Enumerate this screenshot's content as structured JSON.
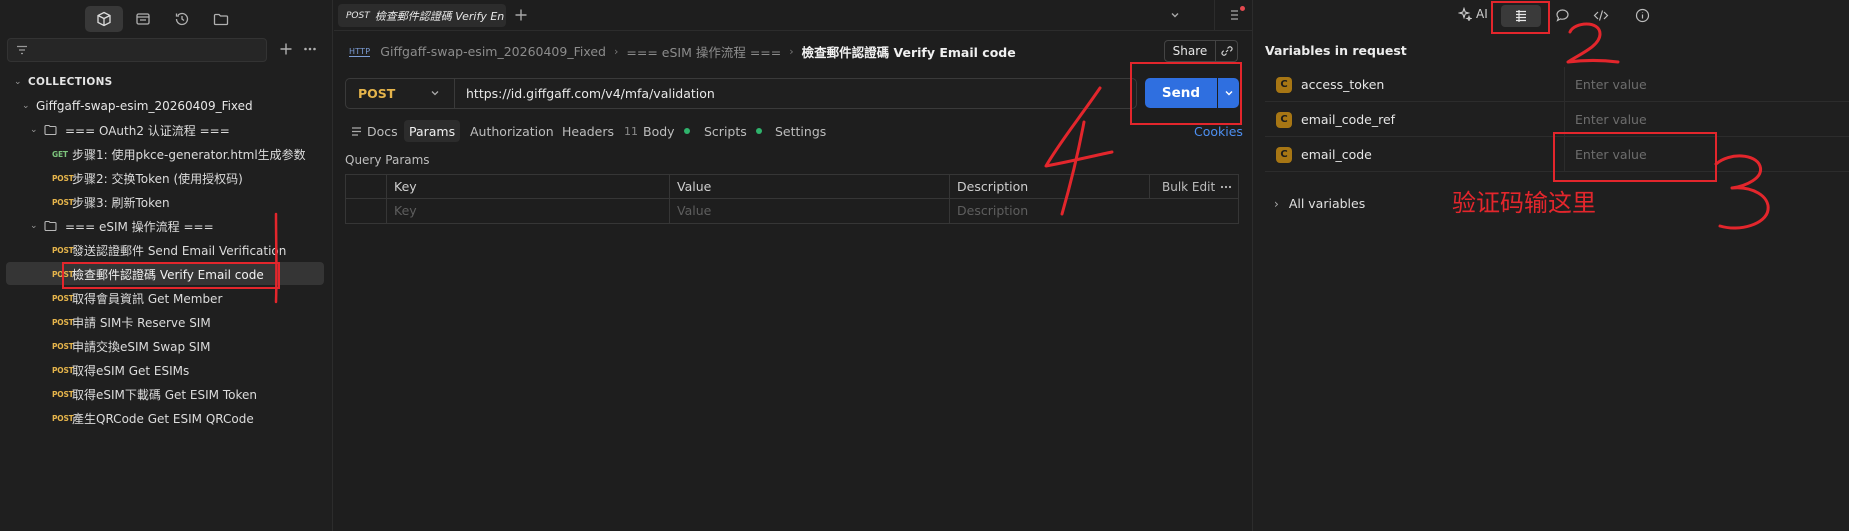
{
  "sidebar": {
    "section_title": "COLLECTIONS",
    "collection_name": "Giffgaff-swap-esim_20260409_Fixed",
    "folders": [
      {
        "name": "=== OAuth2 认证流程 ===",
        "requests": [
          {
            "method": "GET",
            "name": "步骤1: 使用pkce-generator.html生成参数"
          },
          {
            "method": "POST",
            "name": "步骤2: 交换Token (使用授权码)"
          },
          {
            "method": "POST",
            "name": "步骤3: 刷新Token"
          }
        ]
      },
      {
        "name": "=== eSIM 操作流程 ===",
        "requests": [
          {
            "method": "POST",
            "name": "發送認證郵件 Send Email Verification"
          },
          {
            "method": "POST",
            "name": "檢查郵件認證碼 Verify Email code"
          },
          {
            "method": "POST",
            "name": "取得會員資訊 Get Member"
          },
          {
            "method": "POST",
            "name": "申請 SIM卡 Reserve SIM"
          },
          {
            "method": "POST",
            "name": "申請交換eSIM Swap SIM"
          },
          {
            "method": "POST",
            "name": "取得eSIM Get ESIMs"
          },
          {
            "method": "POST",
            "name": "取得eSIM下載碼 Get ESIM Token"
          },
          {
            "method": "POST",
            "name": "產生QRCode Get ESIM QRCode"
          }
        ]
      }
    ]
  },
  "tab": {
    "method": "POST",
    "title": "檢查郵件認證碼 Verify En"
  },
  "breadcrumb": {
    "collection": "Giffgaff-swap-esim_20260409_Fixed",
    "folder": "=== eSIM 操作流程 ===",
    "request": "檢查郵件認證碼 Verify Email code",
    "share_label": "Share",
    "http_badge": "HTTP"
  },
  "request": {
    "method": "POST",
    "url": "https://id.giffgaff.com/v4/mfa/validation",
    "send_label": "Send",
    "tabs": [
      {
        "label": "Docs"
      },
      {
        "label": "Params"
      },
      {
        "label": "Authorization"
      },
      {
        "label": "Headers",
        "count": "11"
      },
      {
        "label": "Body"
      },
      {
        "label": "Scripts"
      },
      {
        "label": "Settings"
      }
    ],
    "cookies_label": "Cookies",
    "query_params_title": "Query Params",
    "columns": {
      "key": "Key",
      "value": "Value",
      "description": "Description"
    },
    "bulk_edit_label": "Bulk Edit",
    "placeholders": {
      "key": "Key",
      "value": "Value",
      "description": "Description"
    }
  },
  "right_toolbar": {
    "ai_label": "AI"
  },
  "variables": {
    "title": "Variables in request",
    "items": [
      {
        "badge": "C",
        "name": "access_token",
        "placeholder": "Enter value"
      },
      {
        "badge": "C",
        "name": "email_code_ref",
        "placeholder": "Enter value"
      },
      {
        "badge": "C",
        "name": "email_code",
        "placeholder": "Enter value"
      }
    ],
    "all_label": "All variables"
  },
  "annotations": {
    "note_text": "验证码输这里",
    "color": "#e3262c"
  },
  "colors": {
    "send_button": "#2f6fe0",
    "post_method": "#e5b44b",
    "get_method": "#7cc47c",
    "variable_badge": "#a77614",
    "active_dot": "#2fb36c",
    "link": "#4d8ff0"
  }
}
